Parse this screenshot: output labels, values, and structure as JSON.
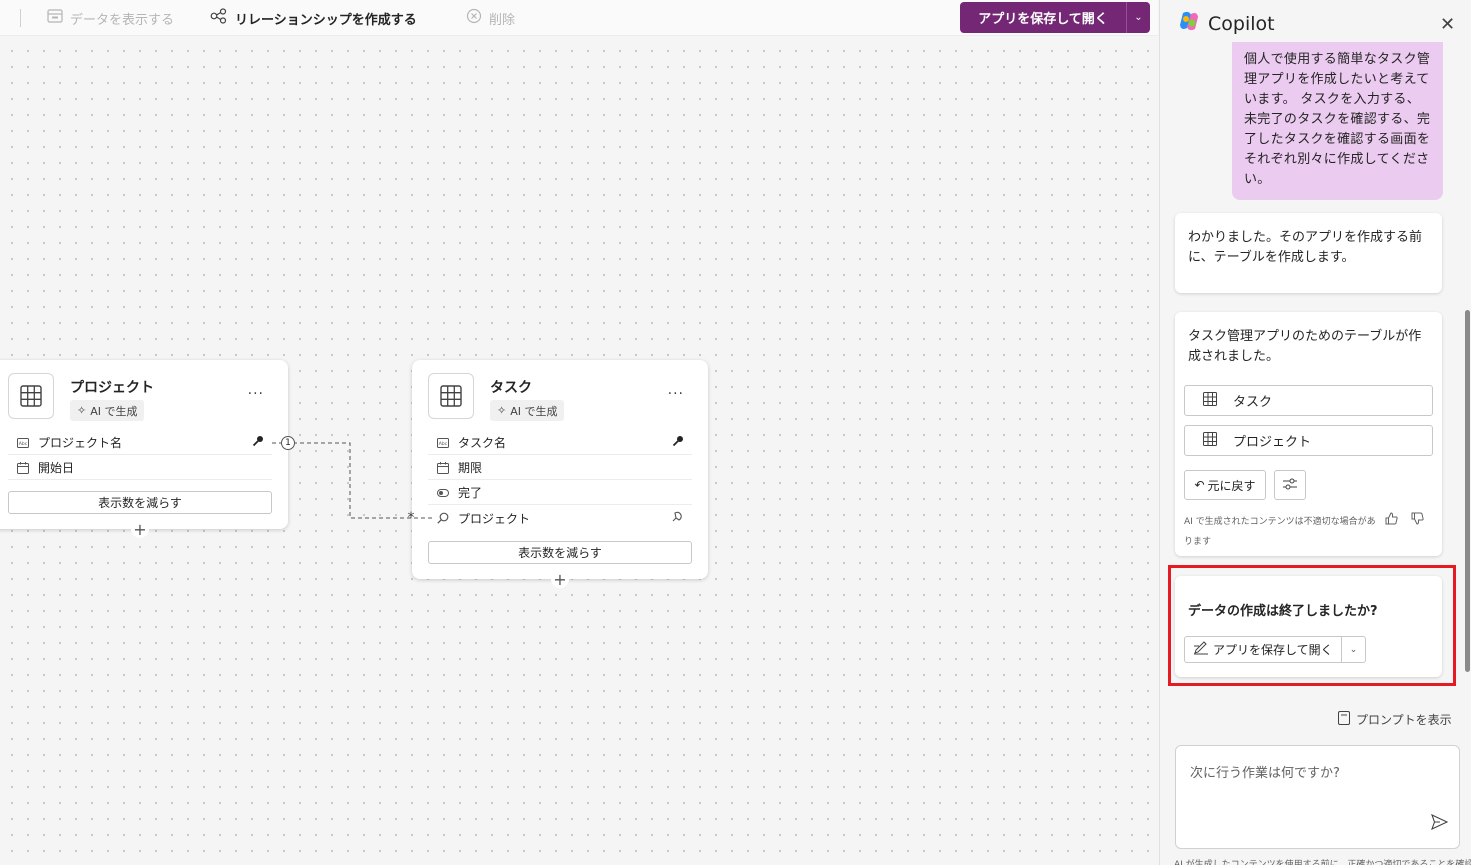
{
  "toolbar": {
    "view_data": "データを表示する",
    "create_relationship": "リレーションシップを作成する",
    "delete": "削除",
    "save_open": "アプリを保存して開く"
  },
  "tables": [
    {
      "title": "プロジェクト",
      "badge": "AI で生成",
      "fields": [
        {
          "icon": "text-field-icon",
          "label": "プロジェクト名",
          "key": true
        },
        {
          "icon": "calendar-icon",
          "label": "開始日"
        }
      ],
      "reduce_label": "表示数を減らす"
    },
    {
      "title": "タスク",
      "badge": "AI で生成",
      "fields": [
        {
          "icon": "text-field-icon",
          "label": "タスク名",
          "key": true
        },
        {
          "icon": "calendar-icon",
          "label": "期限"
        },
        {
          "icon": "toggle-icon",
          "label": "完了"
        },
        {
          "icon": "lookup-icon",
          "label": "プロジェクト"
        }
      ],
      "reduce_label": "表示数を減らす"
    }
  ],
  "relationship": {
    "one_marker": "1",
    "many_marker": "*"
  },
  "copilot": {
    "title": "Copilot",
    "user_message": "個人で使用する簡単なタスク管理アプリを作成したいと考えています。 タスクを入力する、未完了のタスクを確認する、完了したタスクを確認する画面をそれぞれ別々に作成してください。",
    "bot_message_1": "わかりました。そのアプリを作成する前に、テーブルを作成します。",
    "bot_message_2": "タスク管理アプリのためのテーブルが作成されました。",
    "table_buttons": [
      "タスク",
      "プロジェクト"
    ],
    "undo_label": "元に戻す",
    "disclaimer": "AI で生成されたコンテンツは不適切な場合があります",
    "done_question": "データの作成は終了しましたか?",
    "save_open_label": "アプリを保存して開く",
    "show_prompts": "プロンプトを表示",
    "input_placeholder": "次に行う作業は何ですか?",
    "footer": "AI が生成したコンテンツを使用する前に、正確かつ適切であることを確認してください。"
  },
  "colors": {
    "accent": "#742774",
    "user_bubble": "#ebcbef",
    "highlight": "#e51b23"
  }
}
